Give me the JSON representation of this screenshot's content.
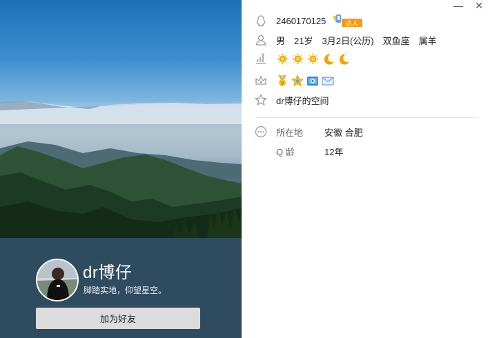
{
  "window": {
    "minimize_glyph": "—",
    "close_glyph": "✕"
  },
  "profile": {
    "nickname": "dr博仔",
    "signature": "脚踏实地，仰望星空。",
    "add_friend_label": "加为好友"
  },
  "info": {
    "qq_number": "2460170125",
    "talent_badge": "达人",
    "gender": "男",
    "age": "21岁",
    "birthday": "3月2日(公历)",
    "constellation": "双鱼座",
    "zodiac": "属羊",
    "level_icons": [
      "sun-icon",
      "sun-icon",
      "sun-icon",
      "moon-icon",
      "moon-icon"
    ],
    "medal_icons": [
      "vip-medal-icon",
      "star-medal-icon",
      "photo-medal-icon",
      "mail-medal-icon"
    ],
    "space_link": "dr博仔的空间"
  },
  "details": {
    "location_label": "所在地",
    "location_value": "安徽 合肥",
    "qage_label": "Q 龄",
    "qage_value": "12年"
  },
  "colors": {
    "band": "#2f4b5f",
    "button": "#dcdcdc",
    "sun": "#f0a500",
    "moon": "#f0a500",
    "badge_orange": "#f29b1b"
  }
}
